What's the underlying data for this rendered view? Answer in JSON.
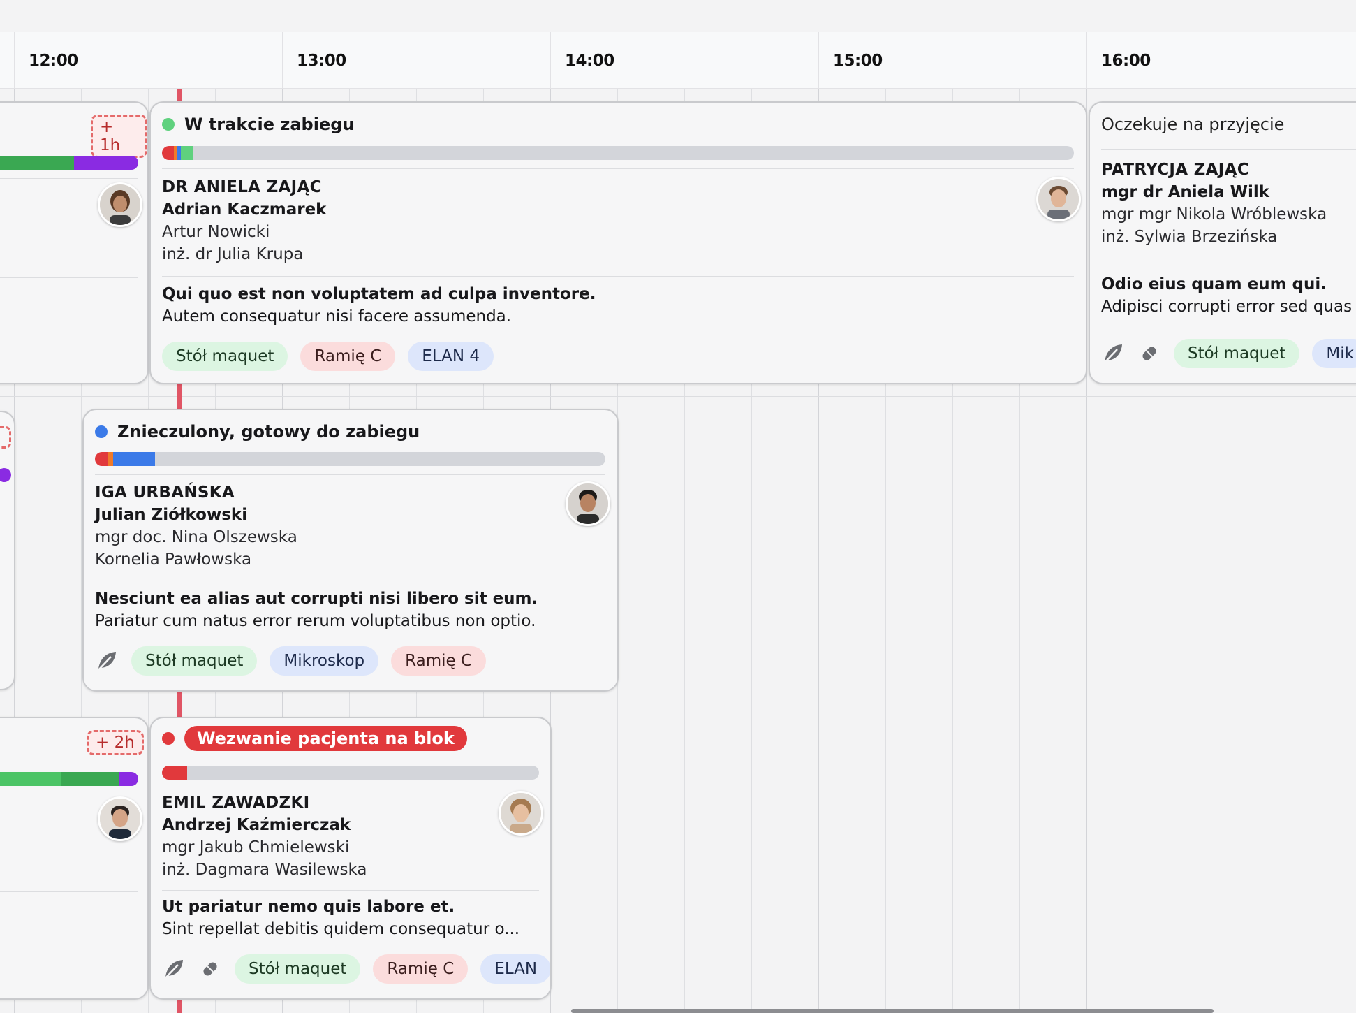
{
  "timeline": {
    "hours": [
      "12:00",
      "13:00",
      "14:00",
      "15:00",
      "16:00"
    ]
  },
  "colors": {
    "status_green": "#5fd17e",
    "status_blue": "#3b7ae8",
    "status_red": "#e1393c",
    "now_line": "#e05565"
  },
  "left_cards": [
    {
      "extra": "+ 1h"
    },
    {
      "extra": "+ 2h"
    }
  ],
  "cards": [
    {
      "status": "W trakcie zabiegu",
      "surgeon": "DR ANIELA ZAJĄC",
      "lead": "Adrian Kaczmarek",
      "staff": [
        "Artur Nowicki",
        "inż. dr Julia Krupa"
      ],
      "title": "Qui quo est non voluptatem ad culpa inventore.",
      "note": "Autem consequatur nisi facere assumenda.",
      "tags": [
        "Stół maquet",
        "Ramię C",
        "ELAN 4"
      ]
    },
    {
      "status": "Oczekuje na przyjęcie",
      "surgeon": "PATRYCJA ZAJĄC",
      "lead": "mgr dr Aniela Wilk",
      "staff": [
        "mgr mgr Nikola Wróblewska",
        "inż. Sylwia Brzezińska"
      ],
      "title": "Odio eius quam eum qui.",
      "note": "Adipisci corrupti error sed quas",
      "icons": [
        "leaf-icon",
        "pill-icon"
      ],
      "tags": [
        "Stół maquet",
        "Mik"
      ]
    },
    {
      "status": "Znieczulony, gotowy do zabiegu",
      "surgeon": "IGA URBAŃSKA",
      "lead": "Julian Ziółkowski",
      "staff": [
        "mgr doc. Nina Olszewska",
        "Kornelia Pawłowska"
      ],
      "title": "Nesciunt ea alias aut corrupti nisi libero sit eum.",
      "note": "Pariatur cum natus error rerum voluptatibus non optio.",
      "icons": [
        "leaf-icon"
      ],
      "tags": [
        "Stół maquet",
        "Mikroskop",
        "Ramię C"
      ]
    },
    {
      "status": "Wezwanie pacjenta na blok",
      "surgeon": "EMIL ZAWADZKI",
      "lead": "Andrzej Kaźmierczak",
      "staff": [
        "mgr Jakub Chmielewski",
        "inż. Dagmara Wasilewska"
      ],
      "title": "Ut pariatur nemo quis labore et.",
      "note": "Sint repellat debitis quidem consequatur o...",
      "icons": [
        "leaf-icon",
        "pill-icon"
      ],
      "tags": [
        "Stół maquet",
        "Ramię C",
        "ELAN"
      ]
    }
  ]
}
